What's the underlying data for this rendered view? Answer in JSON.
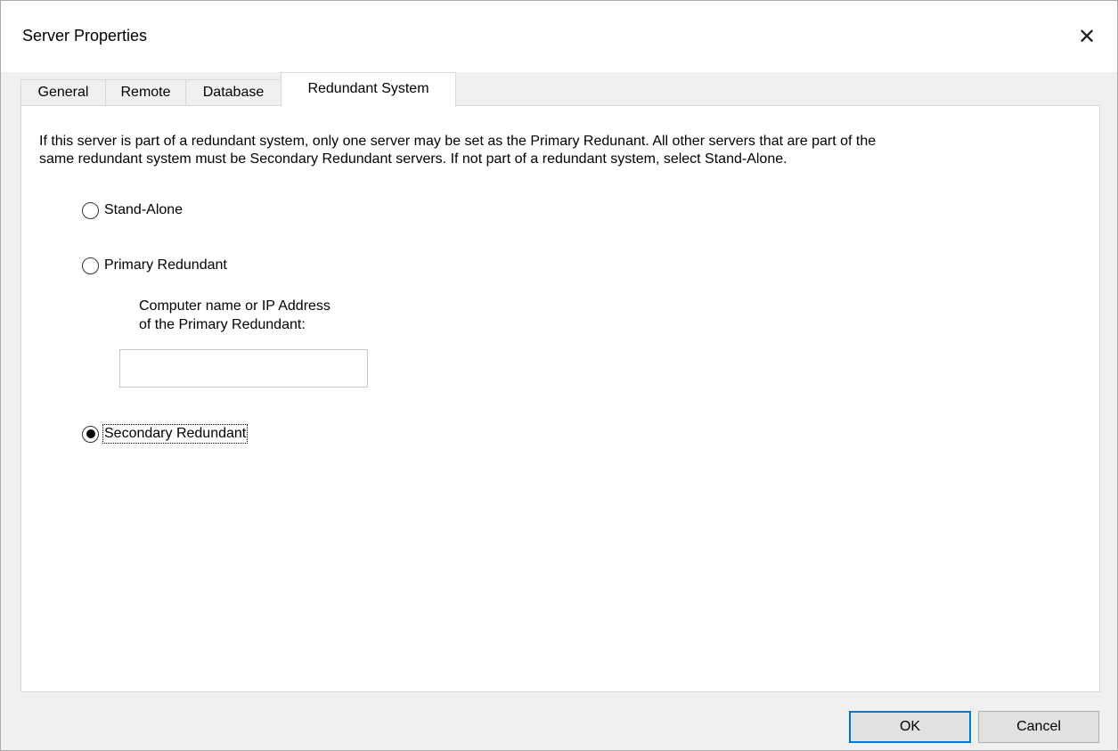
{
  "window": {
    "title": "Server Properties",
    "close_glyph": "✕"
  },
  "tabs": [
    {
      "label": "General",
      "active": false
    },
    {
      "label": "Remote",
      "active": false
    },
    {
      "label": "Database",
      "active": false
    },
    {
      "label": "Redundant System",
      "active": true
    }
  ],
  "panel": {
    "description_line1": "If this server is part of a redundant system, only one server may be set as the Primary Redunant. All other servers that are part of the",
    "description_line2": "same redundant system must be Secondary Redundant servers. If not part of a redundant system, select Stand-Alone.",
    "options": [
      {
        "label": "Stand-Alone",
        "selected": false
      },
      {
        "label": "Primary Redundant",
        "selected": false
      },
      {
        "label": "Secondary Redundant",
        "selected": true
      }
    ],
    "primary_field": {
      "label_line1": "Computer name or IP Address",
      "label_line2": "of the Primary Redundant:",
      "value": "",
      "placeholder": ""
    }
  },
  "buttons": {
    "ok": "OK",
    "cancel": "Cancel"
  },
  "colors": {
    "default_button_border": "#0078d7",
    "panel_bg": "#ffffff",
    "dialog_bg": "#f0f0f0"
  },
  "icons": {
    "close": "close-icon"
  }
}
